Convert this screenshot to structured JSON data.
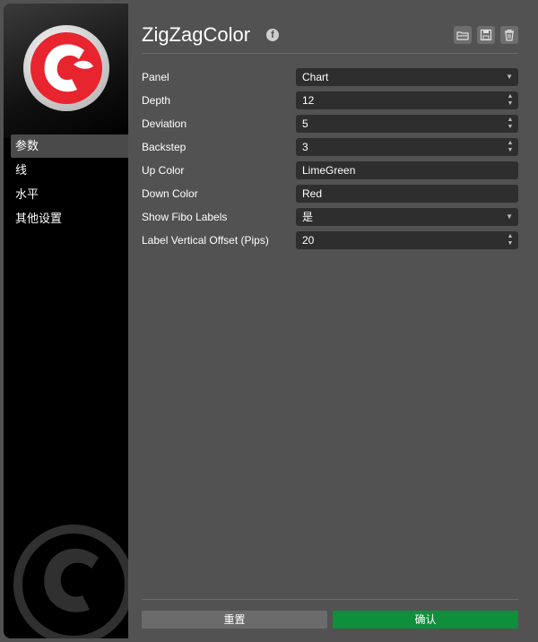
{
  "title": "ZigZagColor",
  "sidebar": {
    "items": [
      {
        "label": "参数",
        "active": true
      },
      {
        "label": "线",
        "active": false
      },
      {
        "label": "水平",
        "active": false
      },
      {
        "label": "其他设置",
        "active": false
      }
    ]
  },
  "form": {
    "fields": [
      {
        "label": "Panel",
        "value": "Chart",
        "type": "select"
      },
      {
        "label": "Depth",
        "value": "12",
        "type": "spinner"
      },
      {
        "label": "Deviation",
        "value": "5",
        "type": "spinner"
      },
      {
        "label": "Backstep",
        "value": "3",
        "type": "spinner"
      },
      {
        "label": "Up Color",
        "value": "LimeGreen",
        "type": "text"
      },
      {
        "label": "Down Color",
        "value": "Red",
        "type": "text"
      },
      {
        "label": "Show Fibo Labels",
        "value": "是",
        "type": "select"
      },
      {
        "label": "Label Vertical Offset (Pips)",
        "value": "20",
        "type": "spinner"
      }
    ]
  },
  "footer": {
    "reset_label": "重置",
    "ok_label": "确认"
  },
  "icons": {
    "header": "facebook-icon",
    "tools": [
      "load-icon",
      "save-icon",
      "delete-icon"
    ]
  },
  "colors": {
    "accent_ok": "#0f8f3b",
    "logo_red": "#e8242f"
  }
}
